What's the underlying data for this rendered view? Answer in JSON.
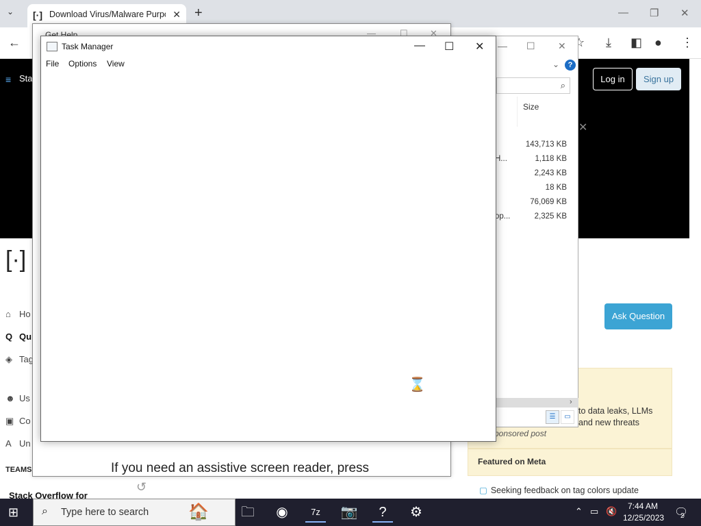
{
  "browser": {
    "tab_title": "Download Virus/Malware Purpo",
    "favicon": "[·]",
    "tab_dropdown": "⌄",
    "tab_close": "✕",
    "new_tab": "+"
  },
  "so": {
    "site_prefix": "Stac",
    "login_label": "Log in",
    "signup_label": "Sign up",
    "nav": [
      {
        "label": "Ho",
        "icon": "⌂"
      },
      {
        "label": "Qu",
        "icon": "Q"
      },
      {
        "label": "Tag",
        "icon": "◈"
      },
      {
        "label": "Us",
        "icon": "☻"
      },
      {
        "label": "Co",
        "icon": "▣"
      },
      {
        "label": "Un",
        "icon": "A"
      }
    ],
    "teams_label": "TEAMS",
    "teams_cta": "Stack Overflow for",
    "ask_label": "Ask Question",
    "blog_text": "to data leaks, LLMs and new threats",
    "sponsored": "ponsored post",
    "meta_heading": "Featured on Meta",
    "meta_item": "Seeking feedback on tag colors update"
  },
  "gethelp": {
    "title": "Get Help",
    "message": "If you need an assistive screen reader, press"
  },
  "explorer": {
    "column_size": "Size",
    "rows": [
      {
        "name": "",
        "size": "143,713 KB"
      },
      {
        "name": "H...",
        "size": "1,118 KB"
      },
      {
        "name": "",
        "size": "2,243 KB"
      },
      {
        "name": "",
        "size": "18 KB"
      },
      {
        "name": "",
        "size": "76,069 KB"
      },
      {
        "name": "op...",
        "size": "2,325 KB"
      }
    ]
  },
  "taskmgr": {
    "title": "Task Manager",
    "menu": [
      "File",
      "Options",
      "View"
    ]
  },
  "taskbar": {
    "search_placeholder": "Type here to search",
    "time": "7:44 AM",
    "date": "12/25/2023",
    "notification_count": "2",
    "apps": [
      {
        "name": "file-explorer",
        "glyph": "🗀"
      },
      {
        "name": "chrome",
        "glyph": "◉"
      },
      {
        "name": "7zip",
        "glyph": "7z"
      },
      {
        "name": "camera",
        "glyph": "📷"
      },
      {
        "name": "get-help",
        "glyph": "?"
      },
      {
        "name": "settings",
        "glyph": "⚙"
      }
    ]
  }
}
